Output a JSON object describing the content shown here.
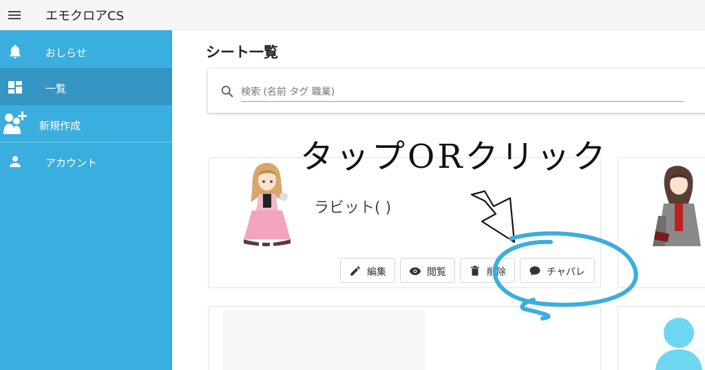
{
  "app": {
    "title": "エモクロアCS"
  },
  "sidebar": {
    "items": [
      {
        "label": "おしらせ",
        "icon": "bell-icon"
      },
      {
        "label": "一覧",
        "icon": "dashboard-icon"
      },
      {
        "label": "新規作成",
        "icon": "add-person-icon"
      },
      {
        "label": "アカウント",
        "icon": "person-icon"
      }
    ]
  },
  "main": {
    "page_title": "シート一覧",
    "search": {
      "placeholder": "検索 (名前 タグ 職業)",
      "value": ""
    },
    "cards": [
      {
        "name": "ラビット( )",
        "actions": [
          {
            "label": "編集",
            "icon": "pencil-icon"
          },
          {
            "label": "閲覧",
            "icon": "eye-icon"
          },
          {
            "label": "削除",
            "icon": "trash-icon"
          },
          {
            "label": "チャパレ",
            "icon": "chat-bubble-icon"
          }
        ]
      }
    ]
  },
  "annotation": {
    "text": "タップORクリック"
  },
  "colors": {
    "sidebar": "#3aaede",
    "sidebar_active": "#3596c4",
    "annotation_circle": "#3aaede"
  }
}
